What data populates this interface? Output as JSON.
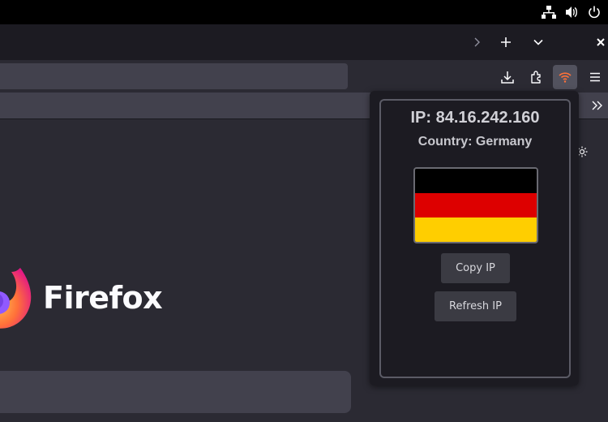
{
  "system_bar": {
    "icons": [
      "network-icon",
      "volume-icon",
      "power-icon"
    ]
  },
  "tab_bar": {
    "icons": [
      "chevron-right-icon",
      "new-tab-icon",
      "tab-list-icon",
      "close-icon"
    ]
  },
  "toolbar": {
    "icons": [
      "download-icon",
      "extensions-icon",
      "ip-extension-icon",
      "menu-icon"
    ],
    "accent": "#ff7139"
  },
  "bookmarks_bar": {
    "overflow_icon": "double-chevron-icon"
  },
  "new_tab_page": {
    "brand": "Firefox",
    "settings_icon": "gear-icon"
  },
  "popup": {
    "ip_label": "IP: 84.16.242.160",
    "country_label": "Country: Germany",
    "flag_colors": [
      "#000000",
      "#dd0000",
      "#ffce00"
    ],
    "copy_button": "Copy IP",
    "refresh_button": "Refresh IP"
  }
}
